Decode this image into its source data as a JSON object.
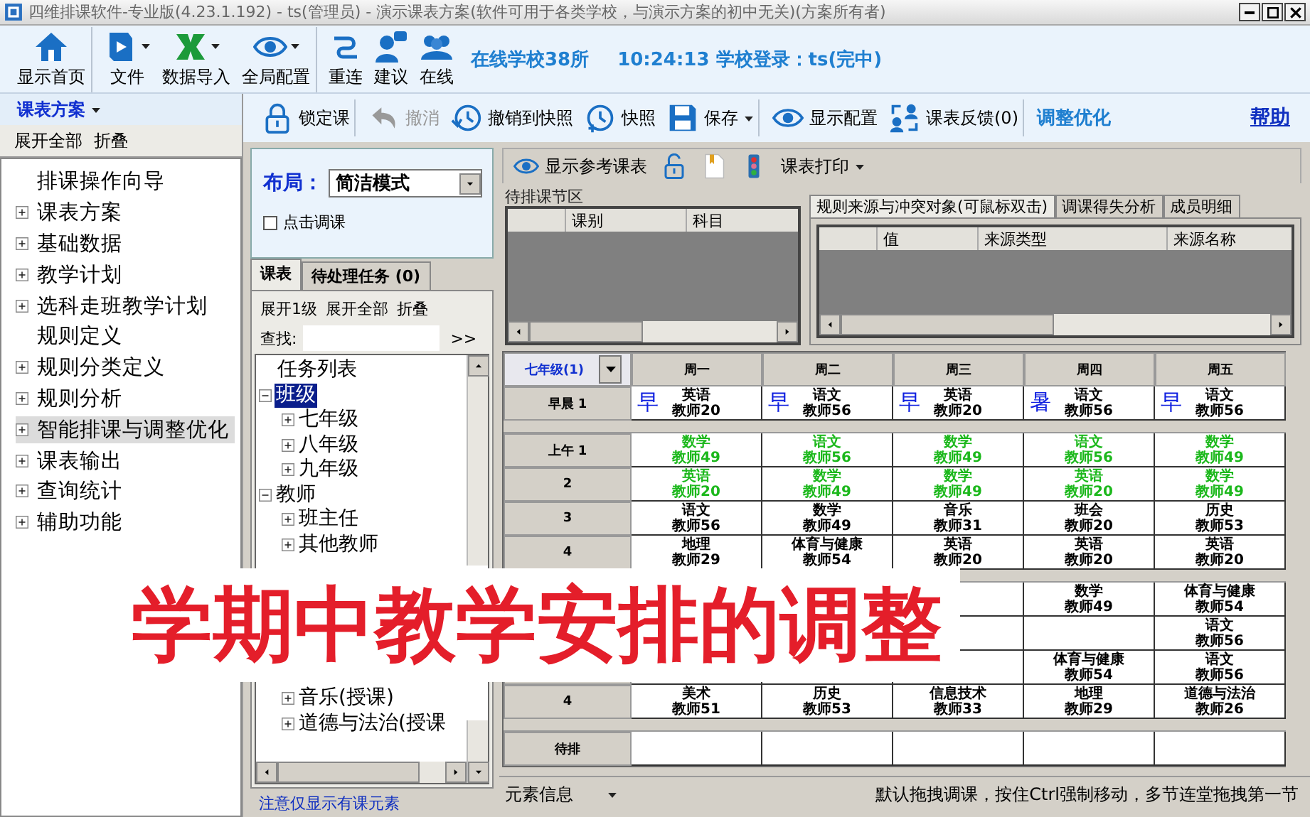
{
  "window": {
    "title": "四维排课软件-专业版(4.23.1.192) - ts(管理员) - 演示课表方案(软件可用于各类学校，与演示方案的初中无关)(方案所有者)"
  },
  "main_toolbar": {
    "buttons": [
      {
        "label": "显示首页",
        "kind": "home",
        "dropdown": false,
        "separator_after": true
      },
      {
        "label": "文件",
        "kind": "book",
        "dropdown": true,
        "separator_after": false
      },
      {
        "label": "数据导入",
        "kind": "excel",
        "dropdown": true,
        "separator_after": false
      },
      {
        "label": "全局配置",
        "kind": "eye",
        "dropdown": true,
        "separator_after": true
      },
      {
        "label": "重连",
        "kind": "plug",
        "dropdown": false,
        "separator_after": false
      },
      {
        "label": "建议",
        "kind": "advice",
        "dropdown": false,
        "separator_after": false
      },
      {
        "label": "在线",
        "kind": "people",
        "dropdown": false,
        "separator_after": false
      }
    ],
    "online_text": "在线学校38所",
    "login_text": "10:24:13 学校登录：ts(完中)"
  },
  "plan_menu": {
    "label": "课表方案",
    "dropdown": true
  },
  "nav_actions": [
    "展开全部",
    "折叠"
  ],
  "nav_tree": [
    {
      "label": "排课操作向导",
      "expandable": false,
      "selected": false
    },
    {
      "label": "课表方案",
      "expandable": true,
      "selected": false
    },
    {
      "label": "基础数据",
      "expandable": true,
      "selected": false
    },
    {
      "label": "教学计划",
      "expandable": true,
      "selected": false
    },
    {
      "label": "选科走班教学计划",
      "expandable": true,
      "selected": false
    },
    {
      "label": "规则定义",
      "expandable": false,
      "selected": false
    },
    {
      "label": "规则分类定义",
      "expandable": true,
      "selected": false
    },
    {
      "label": "规则分析",
      "expandable": true,
      "selected": false
    },
    {
      "label": "智能排课与调整优化",
      "expandable": true,
      "selected": true
    },
    {
      "label": "课表输出",
      "expandable": true,
      "selected": false
    },
    {
      "label": "查询统计",
      "expandable": true,
      "selected": false
    },
    {
      "label": "辅助功能",
      "expandable": true,
      "selected": false
    }
  ],
  "edit_toolbar": {
    "buttons": [
      {
        "label": "锁定课",
        "kind": "lock",
        "disabled": false,
        "dropdown": false,
        "separator_after": true
      },
      {
        "label": "撤消",
        "kind": "undo",
        "disabled": true,
        "dropdown": false,
        "separator_after": false
      },
      {
        "label": "撤销到快照",
        "kind": "history",
        "disabled": false,
        "dropdown": false,
        "separator_after": false
      },
      {
        "label": "快照",
        "kind": "clock",
        "disabled": false,
        "dropdown": false,
        "separator_after": false
      },
      {
        "label": "保存",
        "kind": "save",
        "disabled": false,
        "dropdown": true,
        "separator_after": true
      },
      {
        "label": "显示配置",
        "kind": "eye",
        "disabled": false,
        "dropdown": false,
        "separator_after": false
      },
      {
        "label": "课表反馈(0)",
        "kind": "feedback",
        "disabled": false,
        "dropdown": false,
        "separator_after": true
      },
      {
        "label": "调整优化",
        "kind": "text",
        "disabled": false,
        "dropdown": false,
        "separator_after": false
      }
    ],
    "help_link": "帮助"
  },
  "layout_panel": {
    "label": "布局：",
    "value": "简洁模式",
    "click_adjust": {
      "label": "点击调课",
      "checked": false
    }
  },
  "side_tabs": [
    {
      "label": "课表",
      "selected": true
    },
    {
      "label": "待处理任务 (0)",
      "selected": false
    }
  ],
  "tree_actions": [
    "展开1级",
    "展开全部",
    "折叠"
  ],
  "search": {
    "label": "查找:",
    "button": ">>"
  },
  "task_tree": [
    {
      "label": "任务列表",
      "selected": false
    },
    {
      "label": "班级",
      "selected": true,
      "expanded": true,
      "children": [
        {
          "label": "七年级",
          "expanded": false
        },
        {
          "label": "八年级",
          "expanded": false
        },
        {
          "label": "九年级",
          "expanded": false
        }
      ]
    },
    {
      "label": "教师",
      "selected": false,
      "expanded": true,
      "children": [
        {
          "label": "班主任",
          "expanded": false
        },
        {
          "label": "其他教师",
          "expanded": false
        },
        {
          "label": "音乐(授课)",
          "expanded": false
        },
        {
          "label": "道德与法治(授课",
          "expanded": false
        }
      ]
    }
  ],
  "footer_note": "注意仅显示有课元素",
  "schedule_toolbar": {
    "buttons": [
      {
        "label": "显示参考课表",
        "kind": "eye",
        "dropdown": false
      },
      {
        "kind": "unlock",
        "dropdown": false
      },
      {
        "kind": "document",
        "dropdown": false
      },
      {
        "kind": "traffic-light",
        "dropdown": false
      },
      {
        "label": "课表打印",
        "kind": "text",
        "dropdown": true
      }
    ]
  },
  "pending_area": {
    "title": "待排课节区",
    "columns": [
      "课别",
      "科目"
    ]
  },
  "rule_tabs": [
    {
      "label": "规则来源与冲突对象(可鼠标双击)",
      "selected": true
    },
    {
      "label": "调课得失分析",
      "selected": false
    },
    {
      "label": "成员明细",
      "selected": false
    }
  ],
  "rule_columns": [
    "值",
    "来源类型",
    "来源名称"
  ],
  "schedule": {
    "class_selector": "七年级(1)",
    "days": [
      "周一",
      "周二",
      "周三",
      "周四",
      "周五"
    ],
    "sections": [
      {
        "rows": [
          {
            "label": "早晨 1",
            "cells": [
              {
                "marker": "早",
                "subject": "英语",
                "teacher": "教师20"
              },
              {
                "marker": "早",
                "subject": "语文",
                "teacher": "教师56"
              },
              {
                "marker": "早",
                "subject": "英语",
                "teacher": "教师20"
              },
              {
                "marker": "暑",
                "subject": "语文",
                "teacher": "教师56"
              },
              {
                "marker": "早",
                "subject": "语文",
                "teacher": "教师56"
              }
            ]
          }
        ]
      },
      {
        "rows": [
          {
            "label": "上午 1",
            "color": "#1cb81c",
            "cells": [
              {
                "subject": "数学",
                "teacher": "教师49"
              },
              {
                "subject": "语文",
                "teacher": "教师56"
              },
              {
                "subject": "数学",
                "teacher": "教师49"
              },
              {
                "subject": "语文",
                "teacher": "教师56"
              },
              {
                "subject": "数学",
                "teacher": "教师49"
              }
            ]
          },
          {
            "label": "2",
            "color": "#1cb81c",
            "cells": [
              {
                "subject": "英语",
                "teacher": "教师20"
              },
              {
                "subject": "数学",
                "teacher": "教师49"
              },
              {
                "subject": "数学",
                "teacher": "教师49"
              },
              {
                "subject": "英语",
                "teacher": "教师20"
              },
              {
                "subject": "数学",
                "teacher": "教师49"
              }
            ]
          },
          {
            "label": "3",
            "cells": [
              {
                "subject": "语文",
                "teacher": "教师56"
              },
              {
                "subject": "数学",
                "teacher": "教师49"
              },
              {
                "subject": "音乐",
                "teacher": "教师31"
              },
              {
                "subject": "班会",
                "teacher": "教师20"
              },
              {
                "subject": "历史",
                "teacher": "教师53"
              }
            ]
          },
          {
            "label": "4",
            "cells": [
              {
                "subject": "地理",
                "teacher": "教师29"
              },
              {
                "subject": "体育与健康",
                "teacher": "教师54"
              },
              {
                "subject": "英语",
                "teacher": "教师20"
              },
              {
                "subject": "英语",
                "teacher": "教师20"
              },
              {
                "subject": "英语",
                "teacher": "教师20"
              }
            ]
          }
        ]
      },
      {
        "rows": [
          {
            "cells": [
              {},
              {},
              {},
              {
                "subject": "数学",
                "teacher": "教师49"
              },
              {
                "subject": "体育与健康",
                "teacher": "教师54"
              }
            ]
          },
          {
            "cells": [
              {},
              {},
              {},
              {},
              {
                "subject": "语文",
                "teacher": "教师56"
              }
            ]
          },
          {
            "cells": [
              {},
              {},
              {},
              {
                "subject": "体育与健康",
                "teacher": "教师54"
              },
              {
                "subject": "语文",
                "teacher": "教师56"
              }
            ]
          },
          {
            "label": "4",
            "cells": [
              {
                "subject": "美术",
                "teacher": "教师51"
              },
              {
                "subject": "历史",
                "teacher": "教师53"
              },
              {
                "subject": "信息技术",
                "teacher": "教师33"
              },
              {
                "subject": "地理",
                "teacher": "教师29"
              },
              {
                "subject": "道德与法治",
                "teacher": "教师26"
              }
            ]
          }
        ]
      },
      {
        "rows": [
          {
            "label": "待排",
            "cells": [
              {},
              {},
              {},
              {},
              {}
            ]
          }
        ]
      }
    ]
  },
  "status_bar": {
    "selector": "元素信息",
    "hint": "默认拖拽调课，按住Ctrl强制移动，多节连堂拖拽第一节"
  },
  "overlay_caption": "学期中教学安排的调整"
}
